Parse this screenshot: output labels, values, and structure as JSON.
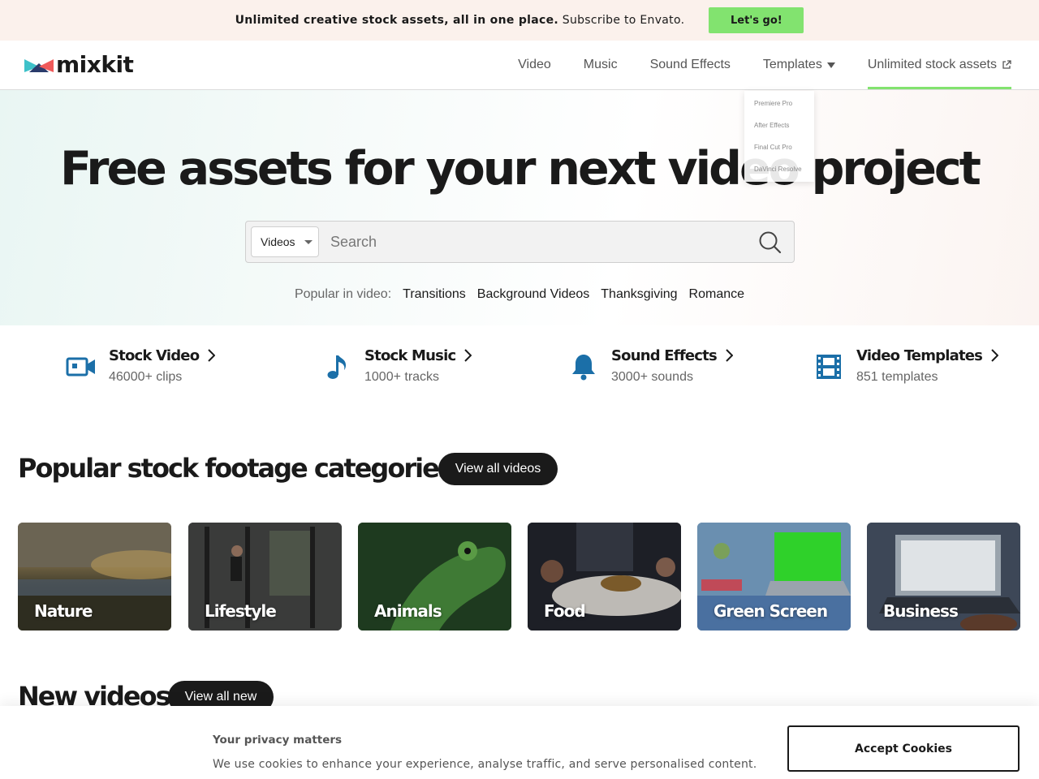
{
  "promo": {
    "text_bold": "Unlimited creative stock assets, all in one place.",
    "text_rest": " Subscribe to Envato.",
    "button": "Let's go!"
  },
  "header": {
    "logo": "mixkit",
    "nav": [
      {
        "label": "Video"
      },
      {
        "label": "Music"
      },
      {
        "label": "Sound Effects"
      },
      {
        "label": "Templates"
      },
      {
        "label": "Unlimited stock assets"
      }
    ],
    "templates_menu": [
      "Premiere Pro",
      "After Effects",
      "Final Cut Pro",
      "DaVinci Resolve"
    ]
  },
  "hero": {
    "title": "Free assets for your next video project",
    "search": {
      "category": "Videos",
      "placeholder": "Search"
    },
    "popular_label": "Popular in video:",
    "popular_links": [
      "Transitions",
      "Background Videos",
      "Thanksgiving",
      "Romance"
    ]
  },
  "assets": [
    {
      "title": "Stock Video",
      "sub": "46000+ clips",
      "icon": "video-camera-icon"
    },
    {
      "title": "Stock Music",
      "sub": "1000+ tracks",
      "icon": "music-note-icon"
    },
    {
      "title": "Sound Effects",
      "sub": "3000+ sounds",
      "icon": "bell-icon"
    },
    {
      "title": "Video Templates",
      "sub": "851 templates",
      "icon": "film-strip-icon"
    }
  ],
  "categories_section": {
    "title": "Popular stock footage categories",
    "button": "View all videos",
    "cards": [
      {
        "label": "Nature"
      },
      {
        "label": "Lifestyle"
      },
      {
        "label": "Animals"
      },
      {
        "label": "Food"
      },
      {
        "label": "Green Screen"
      },
      {
        "label": "Business"
      }
    ]
  },
  "new_section": {
    "title": "New videos",
    "button": "View all new"
  },
  "cookie": {
    "title": "Your privacy matters",
    "text": "We use cookies to enhance your experience, analyse traffic, and serve personalised content.",
    "button": "Accept Cookies"
  },
  "colors": {
    "accent_green": "#82e36f",
    "icon_blue": "#1b6fa8",
    "dark": "#1a1a1a"
  }
}
